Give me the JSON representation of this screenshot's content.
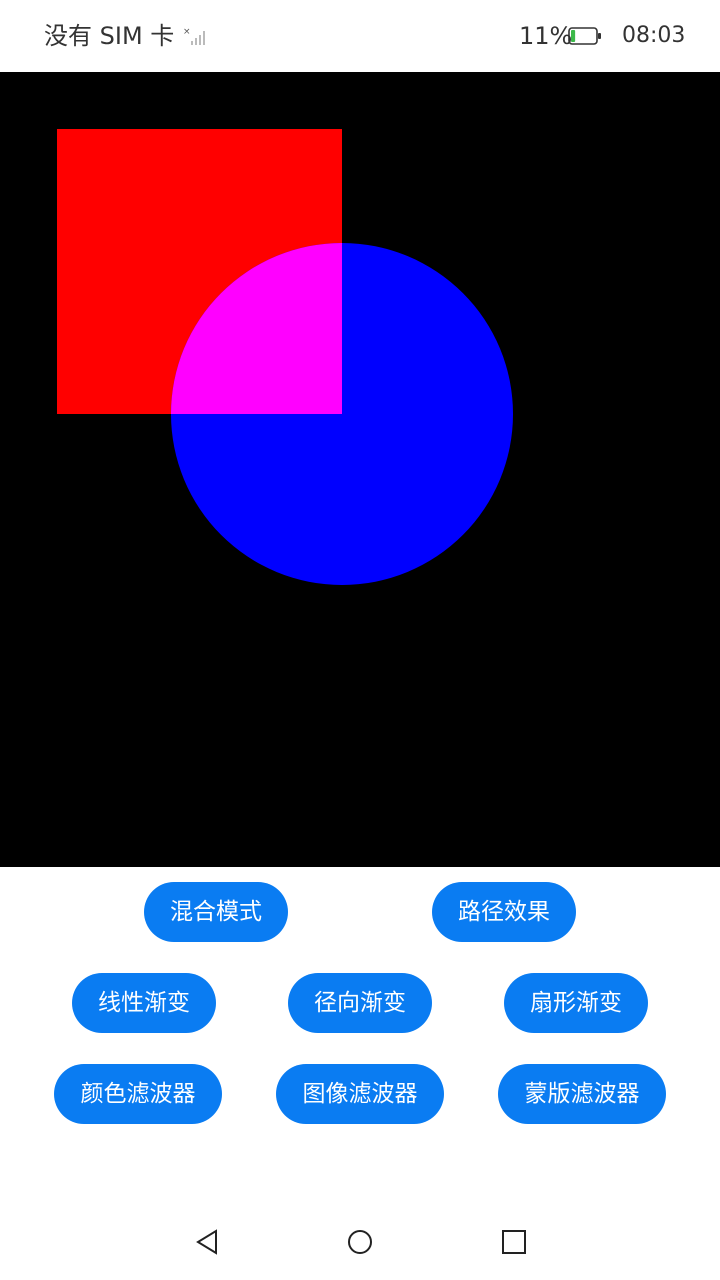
{
  "status_bar": {
    "carrier": "没有 SIM 卡",
    "battery_percent": "11%",
    "battery_level": 0.11,
    "time": "08:03"
  },
  "canvas": {
    "background": "#000000",
    "square_color": "#ff0000",
    "circle_color": "#0000ff",
    "overlap_color": "#ff00ff"
  },
  "buttons": {
    "row1": [
      "混合模式",
      "路径效果"
    ],
    "row2": [
      "线性渐变",
      "径向渐变",
      "扇形渐变"
    ],
    "row3": [
      "颜色滤波器",
      "图像滤波器",
      "蒙版滤波器"
    ]
  },
  "accent_color": "#0a7cf2",
  "nav": {
    "back_icon": "triangle-back",
    "home_icon": "circle-home",
    "recents_icon": "square-recents"
  }
}
